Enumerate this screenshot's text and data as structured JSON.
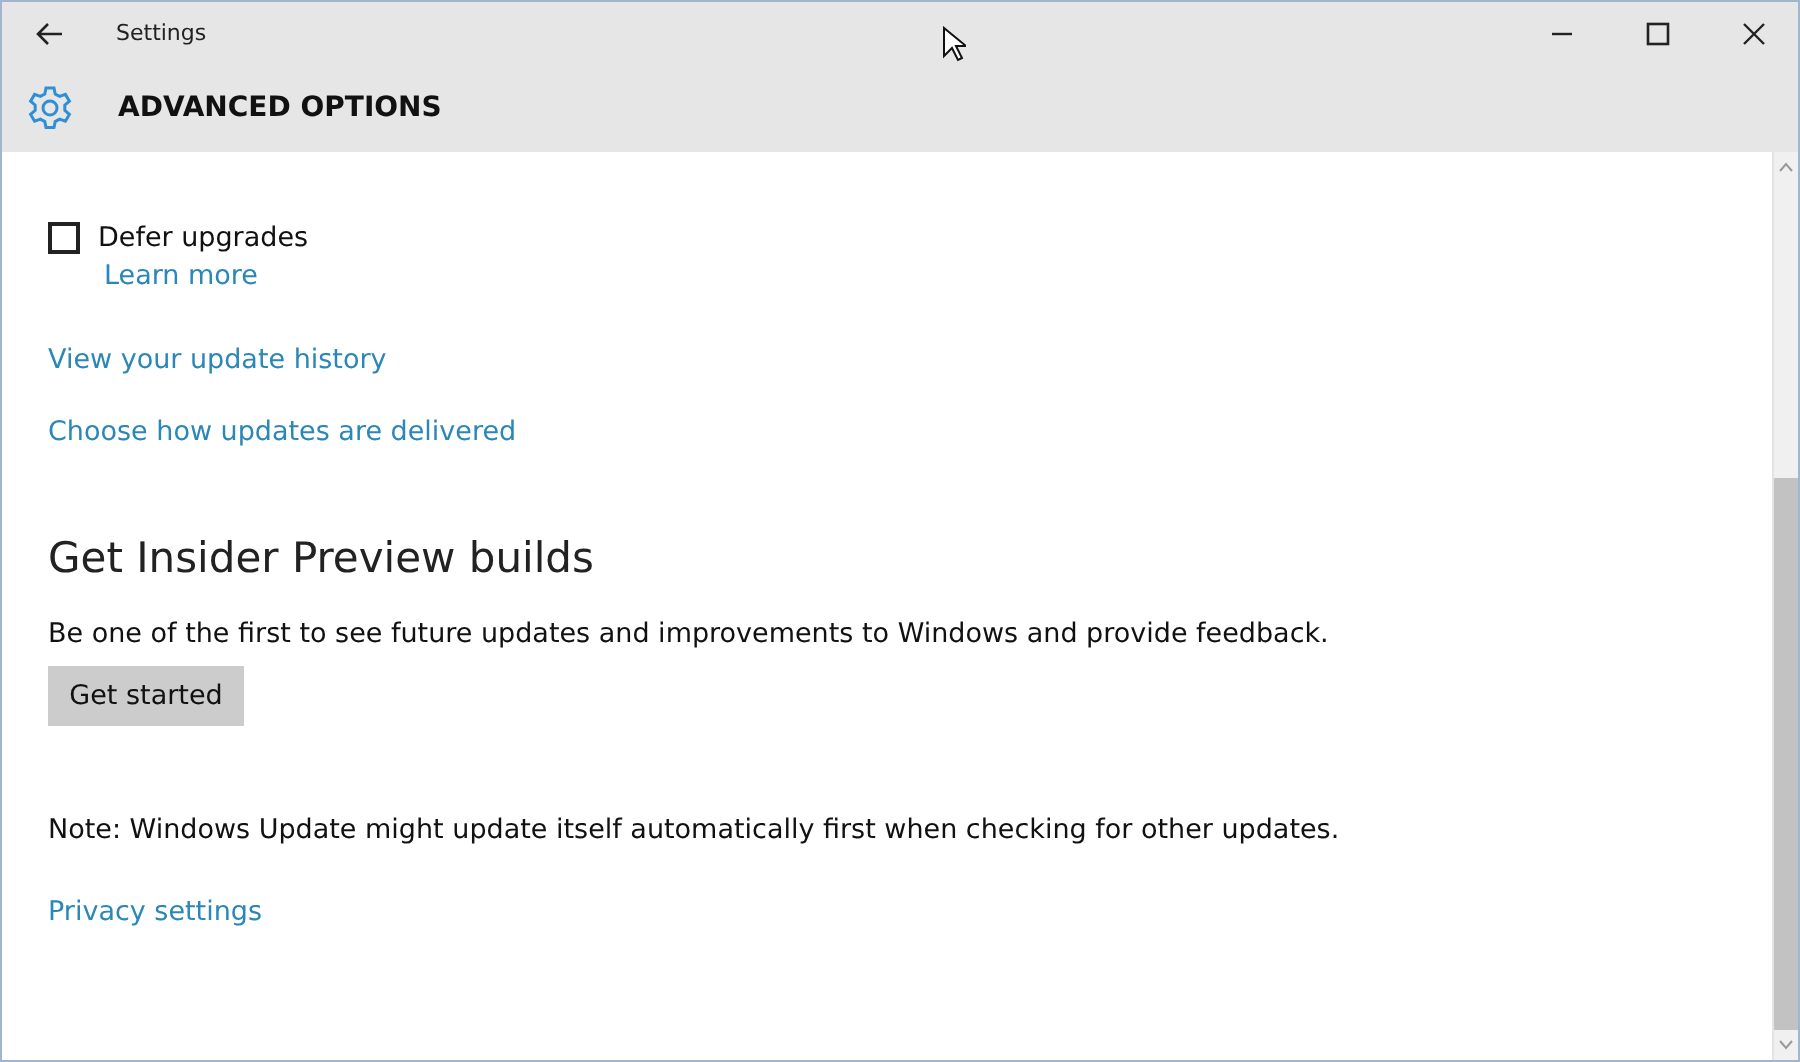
{
  "window": {
    "title": "Settings"
  },
  "header": {
    "title": "ADVANCED OPTIONS"
  },
  "defer_upgrades": {
    "label": "Defer upgrades",
    "checked": false,
    "link": "Learn more"
  },
  "links": [
    "View your update history",
    "Choose how updates are delivered"
  ],
  "insider": {
    "heading": "Get Insider Preview builds",
    "description": "Be one of the first to see future updates and improvements to Windows and provide feedback.",
    "button": "Get started"
  },
  "note": "Note: Windows Update might update itself automatically first when checking for other updates.",
  "privacy_link": "Privacy settings"
}
